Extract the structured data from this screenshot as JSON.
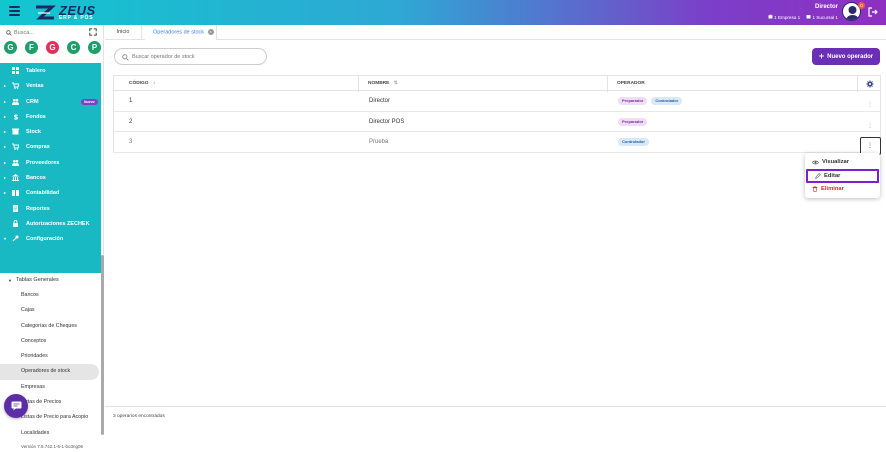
{
  "header": {
    "logo_title": "ZEUS",
    "logo_subtitle": "ERP & POS",
    "user_role": "Director",
    "company": "1 Empresa 1",
    "branch": "1 Sucursal 1",
    "notification_count": "0"
  },
  "sidebar": {
    "search_placeholder": "Busca...",
    "favorites": [
      {
        "letter": "G",
        "color": "#1e9e6a"
      },
      {
        "letter": "F",
        "color": "#1e9e6a"
      },
      {
        "letter": "G",
        "color": "#e0315a"
      },
      {
        "letter": "C",
        "color": "#1e9e6a"
      },
      {
        "letter": "P",
        "color": "#1e9e6a"
      }
    ],
    "items": [
      {
        "label": "Tablero",
        "icon": "dashboard-icon",
        "chevron": false
      },
      {
        "label": "Ventas",
        "icon": "cart-icon",
        "chevron": true
      },
      {
        "label": "CRM",
        "icon": "people-icon",
        "chevron": true,
        "badge": "Nuevo"
      },
      {
        "label": "Fondos",
        "icon": "dollar-icon",
        "chevron": true
      },
      {
        "label": "Stock",
        "icon": "box-icon",
        "chevron": true
      },
      {
        "label": "Compras",
        "icon": "cart-icon",
        "chevron": true
      },
      {
        "label": "Proveedores",
        "icon": "people-icon",
        "chevron": true
      },
      {
        "label": "Bancos",
        "icon": "bank-icon",
        "chevron": true
      },
      {
        "label": "Contabilidad",
        "icon": "book-icon",
        "chevron": true
      },
      {
        "label": "Reportes",
        "icon": "report-icon",
        "chevron": false
      },
      {
        "label": "Autorizaciones ZECHEK",
        "icon": "lock-icon",
        "chevron": false
      },
      {
        "label": "Configuración",
        "icon": "config-icon",
        "chevron": true,
        "expanded": true
      }
    ],
    "submenu_header": "Tablas Generales",
    "submenu_items": [
      "Bancos",
      "Cajas",
      "Categorías de Cheques",
      "Conceptos",
      "Prioridades",
      "Operadores de stock",
      "Empresas",
      "Listas de Precios",
      "Listas de Precio para Acopio",
      "Localidades"
    ],
    "active_submenu": "Operadores de stock",
    "version": "Versión 7.6.742.1-6-1-bo3ng06"
  },
  "tabs": [
    {
      "label": "Inicio"
    },
    {
      "label": "Operadores de stock",
      "closable": true
    }
  ],
  "toolbar": {
    "search_placeholder": "Buscar operador de stock",
    "new_button_label": "Nuevo operador"
  },
  "table": {
    "columns": [
      "CÓDIGO",
      "NOMBRE",
      "OPERADOR"
    ],
    "rows": [
      {
        "codigo": "1",
        "nombre": "Director",
        "operadores": [
          "Preparador",
          "Controlador"
        ]
      },
      {
        "codigo": "2",
        "nombre": "Director POS",
        "operadores": [
          "Preparador"
        ]
      },
      {
        "codigo": "3",
        "nombre": "Prueba",
        "operadores": [
          "Controlador"
        ]
      }
    ]
  },
  "context_menu": {
    "view_label": "Visualizar",
    "edit_label": "Editar",
    "delete_label": "Eliminar"
  },
  "footer": {
    "count_text": "3 operarios encontrados"
  },
  "colors": {
    "header_gradient_start": "#12c6cf",
    "header_gradient_end": "#8e2fc2",
    "sidebar_menu": "#19b9c4",
    "primary_button": "#6a2fb5",
    "chip_preparador": "#efdcf5",
    "chip_controlador": "#d9e9f8",
    "delete": "#d03030"
  }
}
